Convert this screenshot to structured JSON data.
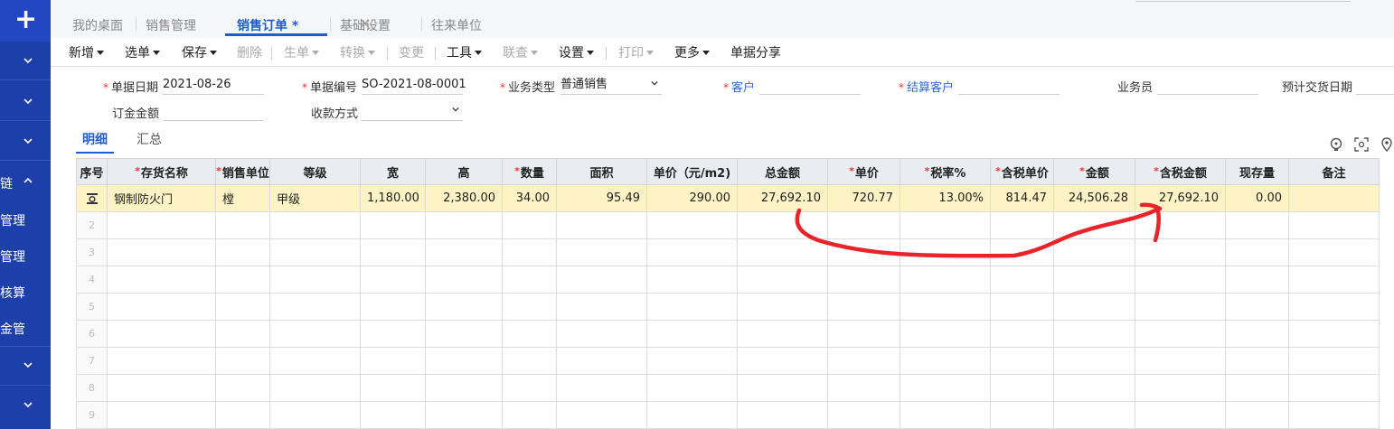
{
  "sidebar": {
    "add_label": "+",
    "items": [
      {
        "label": "",
        "chevron": "down"
      },
      {
        "label": "",
        "chevron": "down"
      },
      {
        "label": "",
        "chevron": "down"
      },
      {
        "label": "链",
        "chevron": "up"
      },
      {
        "label": "管理",
        "chevron": ""
      },
      {
        "label": "管理",
        "chevron": ""
      },
      {
        "label": "核算",
        "chevron": ""
      },
      {
        "label": "金管",
        "chevron": ""
      },
      {
        "label": "",
        "chevron": "down"
      },
      {
        "label": "",
        "chevron": "down"
      }
    ]
  },
  "tabs": [
    {
      "label": "我的桌面"
    },
    {
      "label": "销售管理"
    },
    {
      "label": "销售订单 *"
    },
    {
      "label": "基础设置"
    },
    {
      "label": "往来单位"
    }
  ],
  "tab_close": "×",
  "toolbar": {
    "new": "新增",
    "select": "选单",
    "save": "保存",
    "delete": "删除",
    "generate": "生单",
    "convert": "转换",
    "change": "变更",
    "tools": "工具",
    "linked": "联查",
    "settings": "设置",
    "print": "打印",
    "more": "更多",
    "share": "单据分享"
  },
  "form": {
    "doc_date_label": "单据日期",
    "doc_date_value": "2021-08-26",
    "doc_no_label": "单据编号",
    "doc_no_value": "SO-2021-08-0001",
    "biz_type_label": "业务类型",
    "biz_type_value": "普通销售",
    "customer_label": "客户",
    "customer_value": "",
    "settle_customer_label": "结算客户",
    "settle_customer_value": "",
    "salesperson_label": "业务员",
    "salesperson_value": "",
    "delivery_date_label": "预计交货日期",
    "deposit_label": "订金金额",
    "deposit_value": "",
    "payment_method_label": "收款方式",
    "payment_method_value": ""
  },
  "subtabs": {
    "detail": "明细",
    "summary": "汇总"
  },
  "grid": {
    "headers": [
      "序号",
      "存货名称",
      "销售单位",
      "等级",
      "宽",
      "高",
      "数量",
      "面积",
      "单价（元/m2)",
      "总金额",
      "单价",
      "税率%",
      "含税单价",
      "金额",
      "含税金额",
      "现存量",
      "备注"
    ],
    "rows": [
      [
        "",
        "钢制防火门",
        "樘",
        "甲级",
        "1,180.00",
        "2,380.00",
        "34.00",
        "95.49",
        "290.00",
        "27,692.10",
        "720.77",
        "13.00%",
        "814.47",
        "24,506.28",
        "27,692.10",
        "0.00",
        ""
      ],
      [
        "2",
        "",
        "",
        "",
        "",
        "",
        "",
        "",
        "",
        "",
        "",
        "",
        "",
        "",
        "",
        "",
        ""
      ],
      [
        "3",
        "",
        "",
        "",
        "",
        "",
        "",
        "",
        "",
        "",
        "",
        "",
        "",
        "",
        "",
        "",
        ""
      ],
      [
        "4",
        "",
        "",
        "",
        "",
        "",
        "",
        "",
        "",
        "",
        "",
        "",
        "",
        "",
        "",
        "",
        ""
      ],
      [
        "5",
        "",
        "",
        "",
        "",
        "",
        "",
        "",
        "",
        "",
        "",
        "",
        "",
        "",
        "",
        "",
        ""
      ],
      [
        "6",
        "",
        "",
        "",
        "",
        "",
        "",
        "",
        "",
        "",
        "",
        "",
        "",
        "",
        "",
        "",
        ""
      ],
      [
        "7",
        "",
        "",
        "",
        "",
        "",
        "",
        "",
        "",
        "",
        "",
        "",
        "",
        "",
        "",
        "",
        ""
      ],
      [
        "8",
        "",
        "",
        "",
        "",
        "",
        "",
        "",
        "",
        "",
        "",
        "",
        "",
        "",
        "",
        "",
        ""
      ],
      [
        "9",
        "",
        "",
        "",
        "",
        "",
        "",
        "",
        "",
        "",
        "",
        "",
        "",
        "",
        "",
        "",
        ""
      ]
    ]
  },
  "colors": {
    "sidebar": "#1c3faa",
    "accent": "#1e5dd1",
    "selected_row": "#fdf3c4",
    "annotation": "#e8232a",
    "required": "#e33333"
  }
}
